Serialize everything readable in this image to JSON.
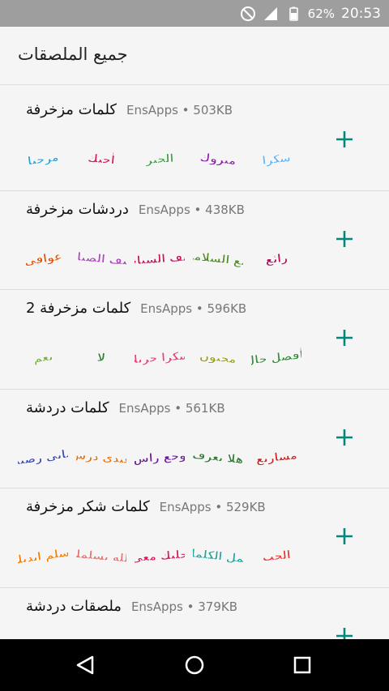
{
  "status_bar": {
    "battery": "62%",
    "time": "20:53"
  },
  "header": {
    "title": "جميع الملصقات"
  },
  "packs": [
    {
      "name": "كلمات مزخرفة",
      "meta": "EnsApps • 503KB",
      "stickers": [
        {
          "text": "مرحبا",
          "color": "#2b9fd6"
        },
        {
          "text": "أحبك",
          "color": "#d81b60"
        },
        {
          "text": "الخير",
          "color": "#43a047"
        },
        {
          "text": "مبروك",
          "color": "#8e24aa"
        },
        {
          "text": "شكرا",
          "color": "#64b5f6"
        }
      ]
    },
    {
      "name": "دردشات مزخرفة",
      "meta": "EnsApps • 438KB",
      "stickers": [
        {
          "text": "عوافي",
          "color": "#e65100"
        },
        {
          "text": "كيف الصبايا",
          "color": "#ab47bc"
        },
        {
          "text": "كيف الشباب",
          "color": "#c2185b"
        },
        {
          "text": "مع السلامة",
          "color": "#558b2f"
        },
        {
          "text": "رائع",
          "color": "#ad1457"
        }
      ]
    },
    {
      "name": "كلمات مزخرفة 2",
      "meta": "EnsApps • 596KB",
      "stickers": [
        {
          "text": "نعم",
          "color": "#7cb342"
        },
        {
          "text": "لا",
          "color": "#2e7d32"
        },
        {
          "text": "شكرا جزيلا",
          "color": "#ec407a"
        },
        {
          "text": "مجنون",
          "color": "#9e9d24"
        },
        {
          "text": "بأفضل حال",
          "color": "#388e3c"
        }
      ]
    },
    {
      "name": "كلمات دردشة",
      "meta": "EnsApps • 561KB",
      "stickers": [
        {
          "text": "ماني رصيد",
          "color": "#3949ab"
        },
        {
          "text": "عندي درس",
          "color": "#ef6c00"
        },
        {
          "text": "وجع راس",
          "color": "#6a1b9a"
        },
        {
          "text": "هلا بعرف",
          "color": "#2e7d32"
        },
        {
          "text": "مشاريع",
          "color": "#c62828"
        }
      ]
    },
    {
      "name": "كلمات شكر مزخرفة",
      "meta": "EnsApps • 529KB",
      "stickers": [
        {
          "text": "تسلم ايديك",
          "color": "#f57c00"
        },
        {
          "text": "الله يسلمك",
          "color": "#e57373"
        },
        {
          "text": "خليك معي",
          "color": "#d81b60"
        },
        {
          "text": "أجمل الكلمات",
          "color": "#26a69a"
        },
        {
          "text": "الحب",
          "color": "#e53935"
        }
      ]
    },
    {
      "name": "ملصقات دردشة",
      "meta": "EnsApps • 379KB",
      "stickers": []
    }
  ],
  "colors": {
    "accent": "#00897b",
    "status_bar": "#9e9e9e",
    "nav_bar": "#000000"
  },
  "icons": {
    "status": [
      "do-not-disturb-icon",
      "signal-icon",
      "battery-icon"
    ],
    "add": "plus-icon",
    "nav": [
      "back-triangle-icon",
      "home-circle-icon",
      "recents-square-icon"
    ]
  }
}
